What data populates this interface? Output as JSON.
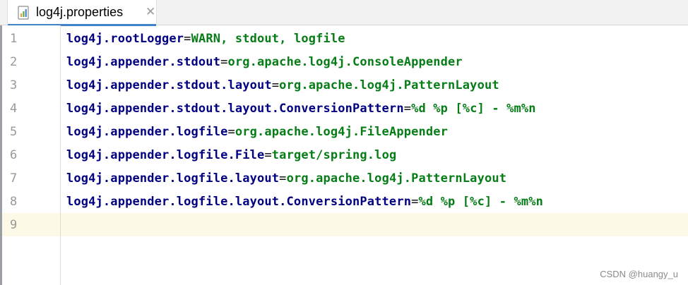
{
  "tab": {
    "title": "log4j.properties",
    "icon": "properties-file-icon",
    "close_icon": "close-icon",
    "close_glyph": "✕"
  },
  "editor": {
    "current_line": 9,
    "lines": [
      {
        "no": "1",
        "key": "log4j.rootLogger",
        "eq": "=",
        "value": "WARN, stdout, logfile"
      },
      {
        "no": "2",
        "key": "log4j.appender.stdout",
        "eq": "=",
        "value": "org.apache.log4j.ConsoleAppender"
      },
      {
        "no": "3",
        "key": "log4j.appender.stdout.layout",
        "eq": "=",
        "value": "org.apache.log4j.PatternLayout"
      },
      {
        "no": "4",
        "key": "log4j.appender.stdout.layout.ConversionPattern",
        "eq": "=",
        "value": "%d %p [%c] - %m%n"
      },
      {
        "no": "5",
        "key": "log4j.appender.logfile",
        "eq": "=",
        "value": "org.apache.log4j.FileAppender"
      },
      {
        "no": "6",
        "key": "log4j.appender.logfile.File",
        "eq": "=",
        "value": "target/spring.log"
      },
      {
        "no": "7",
        "key": "log4j.appender.logfile.layout",
        "eq": "=",
        "value": "org.apache.log4j.PatternLayout"
      },
      {
        "no": "8",
        "key": "log4j.appender.logfile.layout.ConversionPattern",
        "eq": "=",
        "value": "%d %p [%c] - %m%n"
      },
      {
        "no": "9",
        "key": "",
        "eq": "",
        "value": ""
      }
    ]
  },
  "watermark": "CSDN @huangy_u",
  "colors": {
    "key": "#000080",
    "value": "#067d17",
    "current_line_bg": "#fcfae6",
    "tab_underline": "#4083c9"
  }
}
